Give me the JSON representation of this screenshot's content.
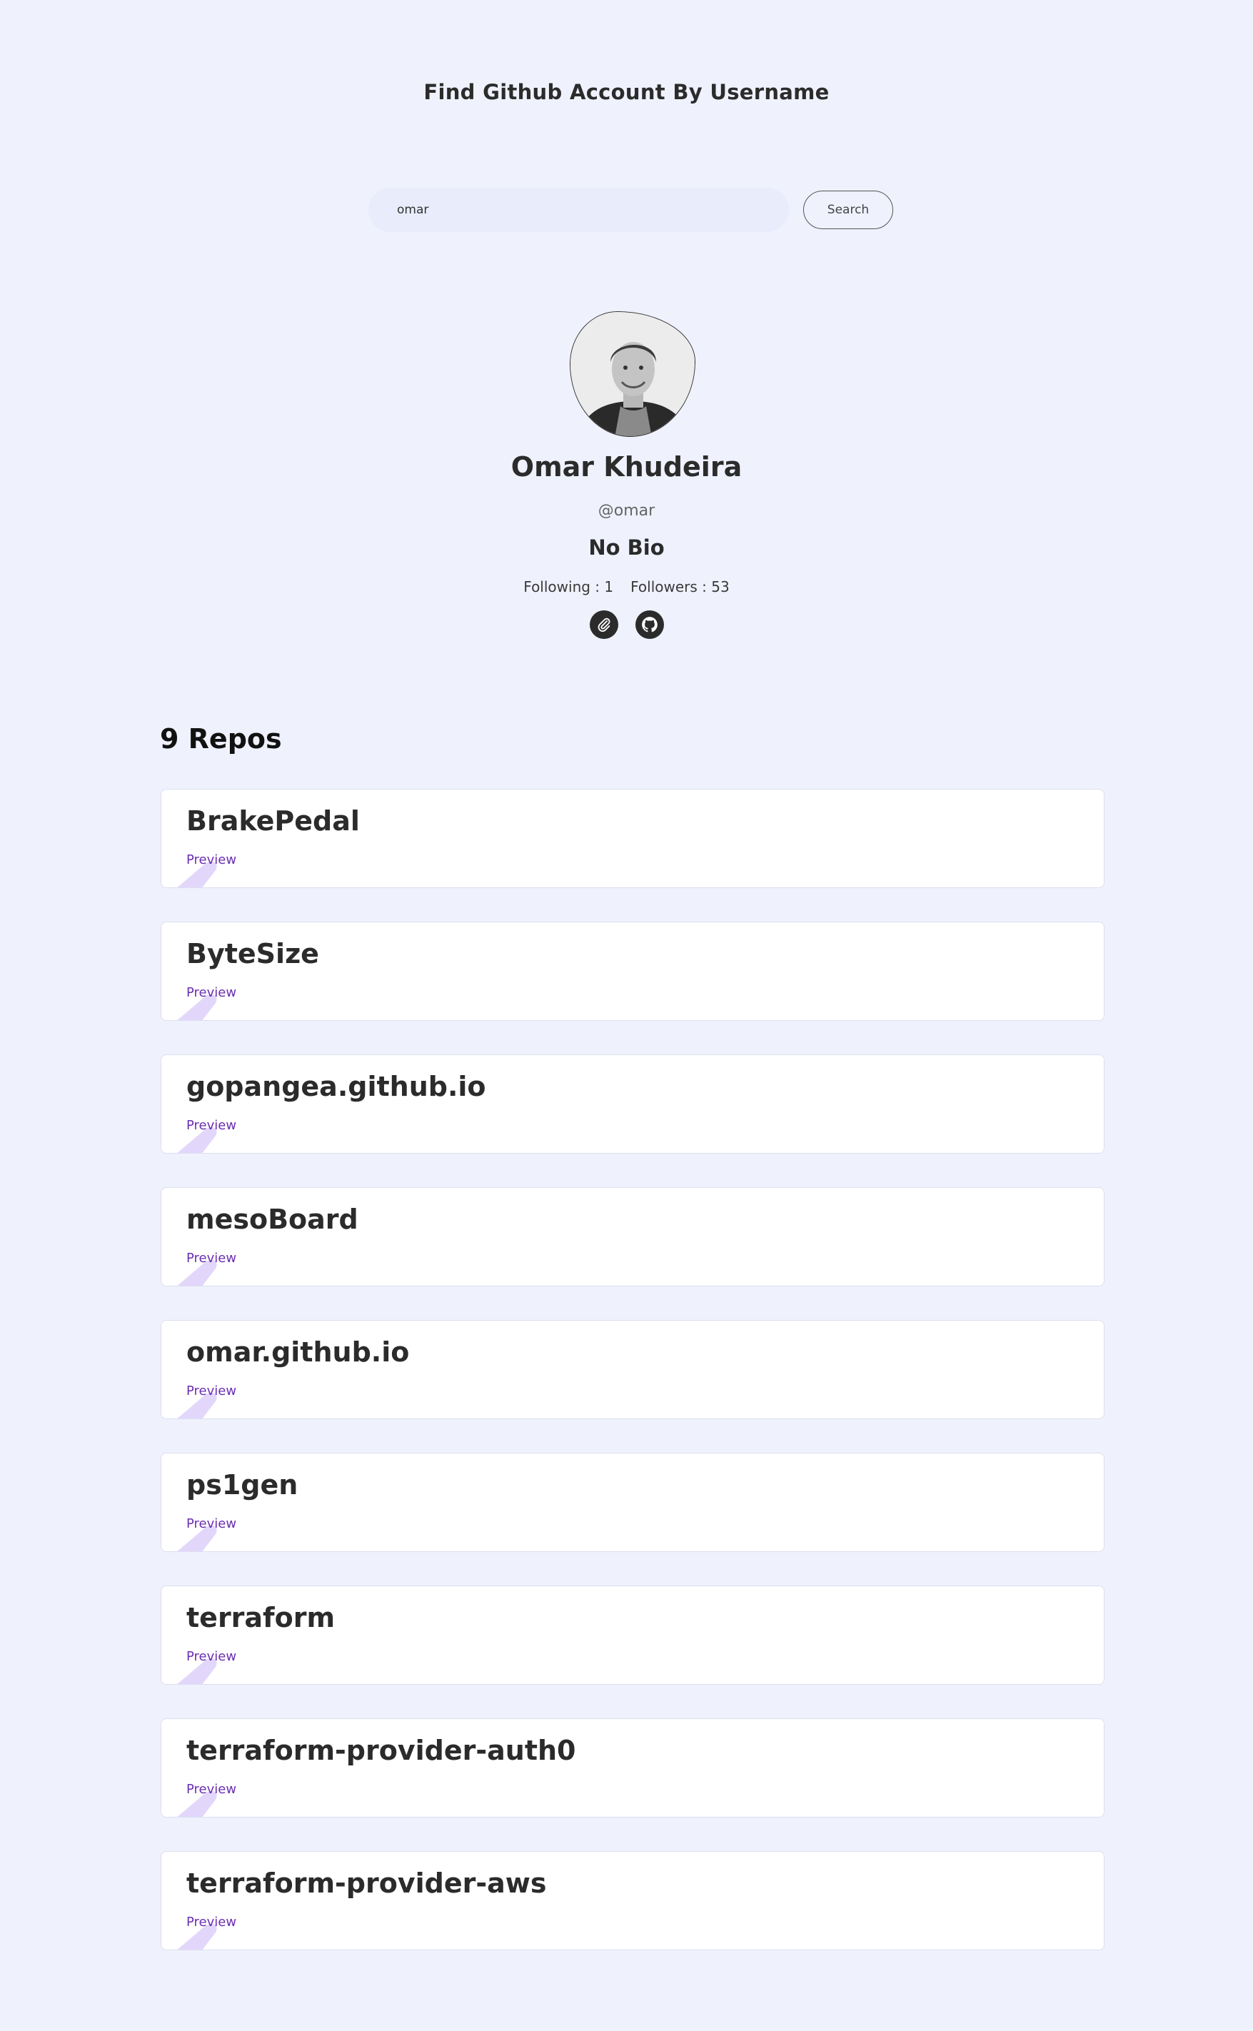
{
  "header": {
    "title": "Find Github Account By Username"
  },
  "search": {
    "value": "omar",
    "button_label": "Search"
  },
  "profile": {
    "name": "Omar Khudeira",
    "handle": "@omar",
    "bio": "No Bio",
    "following_label": "Following : 1",
    "followers_label": "Followers : 53",
    "links": [
      {
        "icon": "paperclip-icon"
      },
      {
        "icon": "github-icon"
      }
    ]
  },
  "repos": {
    "heading": "9 Repos",
    "items": [
      {
        "name": "BrakePedal",
        "preview_label": "Preview"
      },
      {
        "name": "ByteSize",
        "preview_label": "Preview"
      },
      {
        "name": "gopangea.github.io",
        "preview_label": "Preview"
      },
      {
        "name": "mesoBoard",
        "preview_label": "Preview"
      },
      {
        "name": "omar.github.io",
        "preview_label": "Preview"
      },
      {
        "name": "ps1gen",
        "preview_label": "Preview"
      },
      {
        "name": "terraform",
        "preview_label": "Preview"
      },
      {
        "name": "terraform-provider-auth0",
        "preview_label": "Preview"
      },
      {
        "name": "terraform-provider-aws",
        "preview_label": "Preview"
      }
    ]
  },
  "colors": {
    "background": "#eff1fd",
    "accent": "#6b2fb3",
    "swoosh": "#e2d7fb",
    "text": "#2b2b2b"
  }
}
